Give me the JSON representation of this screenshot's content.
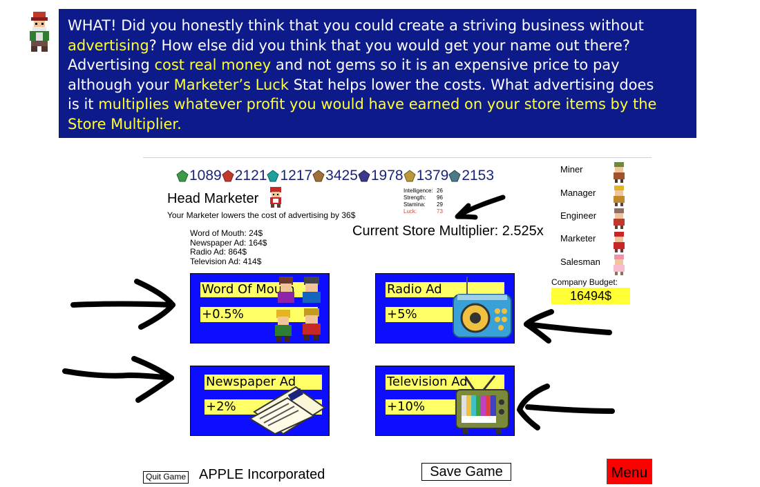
{
  "tutorial": {
    "line1": "WHAT! Did you honestly think that you could create a striving business without",
    "line2_hl": "advertising",
    "line2_rest": "? How else did you think that you would get your name out there?",
    "line3_pre": "Advertising ",
    "line3_hl": "cost real money",
    "line3_rest": " and not gems so it is an expensive price to pay",
    "line4_pre": "although your ",
    "line4_hl": "Marketer’s Luck",
    "line4_rest": " Stat helps lower the costs. What advertising does",
    "line5_pre": "is it ",
    "line5_hl": "multiplies whatever profit you would have earned on your store items by the",
    "line6_hl": "Store Multiplier."
  },
  "gems": [
    {
      "value": "1089",
      "color": "#3a9a4a"
    },
    {
      "value": "2121",
      "color": "#c0392b"
    },
    {
      "value": "1217",
      "color": "#1f9e9e"
    },
    {
      "value": "3425",
      "color": "#a0703a"
    },
    {
      "value": "1978",
      "color": "#3a3a8a"
    },
    {
      "value": "1379",
      "color": "#b8983a"
    },
    {
      "value": "2153",
      "color": "#4a7a8a"
    }
  ],
  "head_marketer": {
    "title": "Head Marketer",
    "description": "Your Marketer lowers the cost of advertising by 36$"
  },
  "stats": {
    "intelligence_label": "Intelligence:",
    "intelligence": "26",
    "strength_label": "Strength:",
    "strength": "96",
    "stamina_label": "Stamina:",
    "stamina": "29",
    "luck_label": "Luck:",
    "luck": "73"
  },
  "costs": {
    "word_of_mouth": "Word of Mouth: 24$",
    "newspaper": "Newspaper Ad: 164$",
    "radio": "Radio Ad: 864$",
    "television": "Television Ad: 414$"
  },
  "multiplier": "Current Store Multiplier: 2.525x",
  "staff": [
    "Miner",
    "Manager",
    "Engineer",
    "Marketer",
    "Salesman"
  ],
  "budget": {
    "label": "Company Budget:",
    "value": "16494$"
  },
  "ads": {
    "wom": {
      "name": "Word Of Mouth",
      "pct": "+0.5%"
    },
    "radio": {
      "name": "Radio Ad",
      "pct": "+5%"
    },
    "newspaper": {
      "name": "Newspaper Ad",
      "pct": "+2%"
    },
    "tv": {
      "name": "Television Ad",
      "pct": "+10%"
    }
  },
  "footer": {
    "quit": "Quit Game",
    "company": "APPLE Incorporated",
    "save": "Save Game",
    "menu": "Menu"
  },
  "colors": {
    "banner": "#0d1a8a",
    "highlight": "#ffff33",
    "card": "#0d0dff",
    "menu": "#ff0000"
  }
}
